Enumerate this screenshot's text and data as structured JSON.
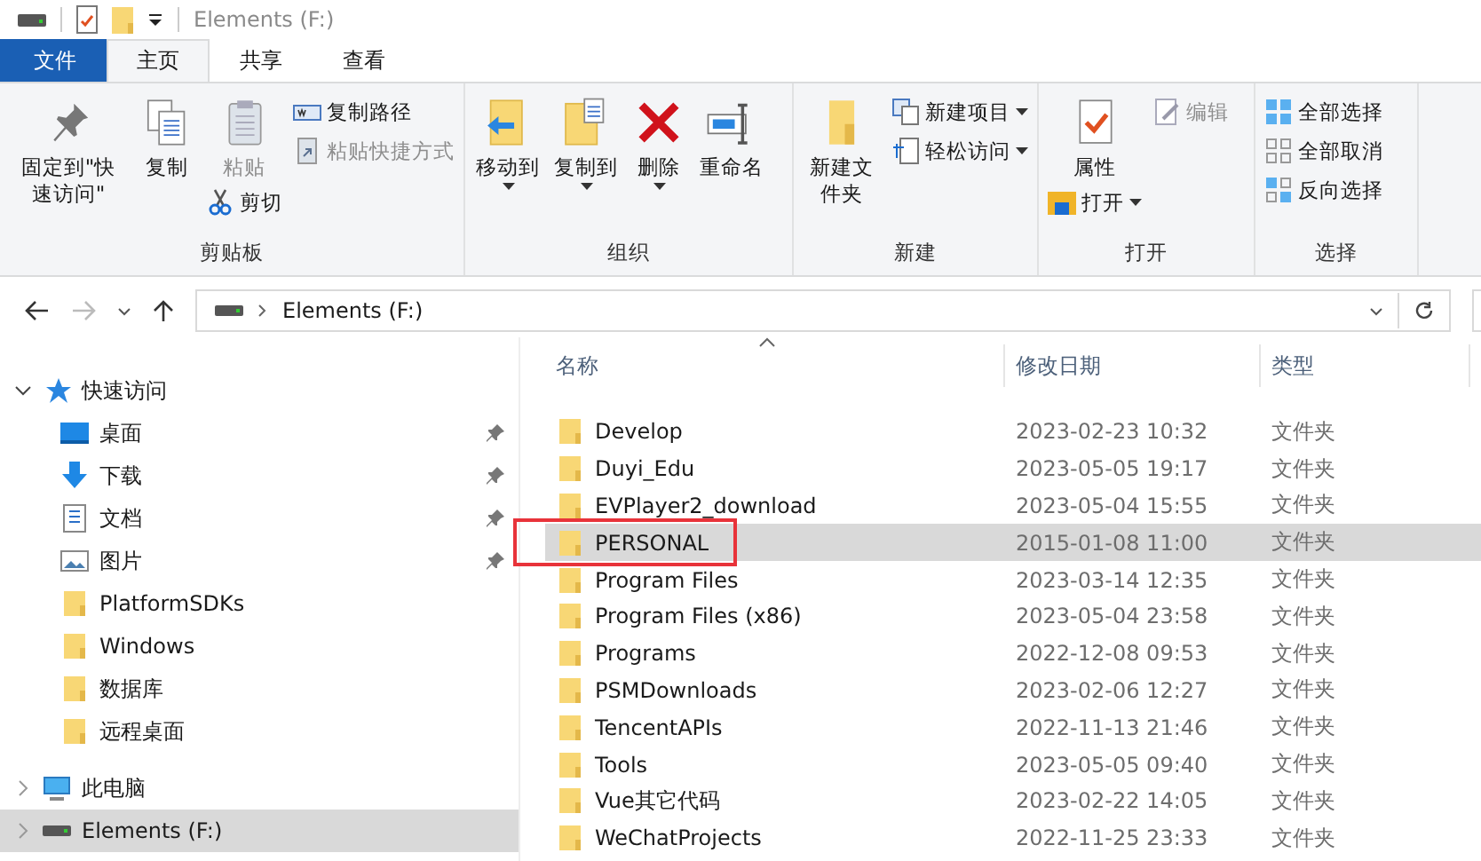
{
  "window": {
    "title": "Elements (F:)"
  },
  "tabs": [
    {
      "label": "文件",
      "kind": "file",
      "selected": false
    },
    {
      "label": "主页",
      "kind": "tab",
      "selected": true
    },
    {
      "label": "共享",
      "kind": "tab",
      "selected": false
    },
    {
      "label": "查看",
      "kind": "tab",
      "selected": false
    }
  ],
  "ribbon": {
    "groups": [
      {
        "label": "剪贴板",
        "items": [
          {
            "kind": "large",
            "label": "固定到\"快速访问\"",
            "disabled": false,
            "dropdown": false
          },
          {
            "kind": "large",
            "label": "复制",
            "disabled": false,
            "dropdown": false
          },
          {
            "kind": "large",
            "label": "粘贴",
            "disabled": true,
            "dropdown": false,
            "below": {
              "label": "剪切",
              "disabled": false,
              "dropdown": false
            }
          },
          {
            "kind": "column",
            "items": [
              {
                "label": "复制路径",
                "disabled": false,
                "dropdown": false
              },
              {
                "label": "粘贴快捷方式",
                "disabled": true,
                "dropdown": false
              }
            ]
          }
        ]
      },
      {
        "label": "组织",
        "items": [
          {
            "kind": "large",
            "label": "移动到",
            "disabled": false,
            "dropdown": true
          },
          {
            "kind": "large",
            "label": "复制到",
            "disabled": false,
            "dropdown": true
          },
          {
            "kind": "large",
            "label": "删除",
            "disabled": false,
            "dropdown": true
          },
          {
            "kind": "large",
            "label": "重命名",
            "disabled": false,
            "dropdown": false
          }
        ]
      },
      {
        "label": "新建",
        "items": [
          {
            "kind": "large",
            "label": "新建文件夹",
            "disabled": false,
            "dropdown": false
          },
          {
            "kind": "column",
            "items": [
              {
                "label": "新建项目",
                "disabled": false,
                "dropdown": true
              },
              {
                "label": "轻松访问",
                "disabled": false,
                "dropdown": true
              }
            ]
          }
        ]
      },
      {
        "label": "打开",
        "items": [
          {
            "kind": "large",
            "label": "属性",
            "disabled": false,
            "dropdown": false,
            "below": {
              "label": "打开",
              "disabled": false,
              "dropdown": true
            }
          },
          {
            "kind": "column",
            "items": [
              {
                "label": "编辑",
                "disabled": true,
                "dropdown": false
              }
            ]
          }
        ]
      },
      {
        "label": "选择",
        "items": [
          {
            "kind": "column",
            "items": [
              {
                "label": "全部选择",
                "disabled": false,
                "dropdown": false
              },
              {
                "label": "全部取消",
                "disabled": false,
                "dropdown": false
              },
              {
                "label": "反向选择",
                "disabled": false,
                "dropdown": false
              }
            ]
          }
        ]
      }
    ]
  },
  "address": {
    "path": "Elements (F:)"
  },
  "sidebar": {
    "items": [
      {
        "label": "快速访问",
        "kind": "star",
        "expanded": true,
        "selected": false,
        "children": [
          {
            "label": "桌面",
            "kind": "desktop",
            "pinned": true
          },
          {
            "label": "下载",
            "kind": "downloads",
            "pinned": true
          },
          {
            "label": "文档",
            "kind": "documents",
            "pinned": true
          },
          {
            "label": "图片",
            "kind": "pictures",
            "pinned": true
          },
          {
            "label": "PlatformSDKs",
            "kind": "folder",
            "pinned": false
          },
          {
            "label": "Windows",
            "kind": "folder",
            "pinned": false
          },
          {
            "label": "数据库",
            "kind": "folder",
            "pinned": false
          },
          {
            "label": "远程桌面",
            "kind": "folder",
            "pinned": false
          }
        ]
      },
      {
        "label": "此电脑",
        "kind": "pc",
        "expanded": false,
        "selected": false
      },
      {
        "label": "Elements (F:)",
        "kind": "drive",
        "expanded": false,
        "selected": true
      }
    ]
  },
  "table": {
    "columns": [
      "名称",
      "修改日期",
      "类型"
    ],
    "rows": [
      {
        "name": "Develop",
        "date": "2023-02-23 10:32",
        "type": "文件夹",
        "selected": false,
        "annotated": false
      },
      {
        "name": "Duyi_Edu",
        "date": "2023-05-05 19:17",
        "type": "文件夹",
        "selected": false,
        "annotated": false
      },
      {
        "name": "EVPlayer2_download",
        "date": "2023-05-04 15:55",
        "type": "文件夹",
        "selected": false,
        "annotated": false
      },
      {
        "name": "PERSONAL",
        "date": "2015-01-08 11:00",
        "type": "文件夹",
        "selected": true,
        "annotated": true
      },
      {
        "name": "Program Files",
        "date": "2023-03-14 12:35",
        "type": "文件夹",
        "selected": false,
        "annotated": false
      },
      {
        "name": "Program Files (x86)",
        "date": "2023-05-04 23:58",
        "type": "文件夹",
        "selected": false,
        "annotated": false
      },
      {
        "name": "Programs",
        "date": "2022-12-08 09:53",
        "type": "文件夹",
        "selected": false,
        "annotated": false
      },
      {
        "name": "PSMDownloads",
        "date": "2023-02-06 12:27",
        "type": "文件夹",
        "selected": false,
        "annotated": false
      },
      {
        "name": "TencentAPIs",
        "date": "2022-11-13 21:46",
        "type": "文件夹",
        "selected": false,
        "annotated": false
      },
      {
        "name": "Tools",
        "date": "2023-05-05 09:40",
        "type": "文件夹",
        "selected": false,
        "annotated": false
      },
      {
        "name": "Vue其它代码",
        "date": "2023-02-22 14:05",
        "type": "文件夹",
        "selected": false,
        "annotated": false
      },
      {
        "name": "WeChatProjects",
        "date": "2022-11-25 23:33",
        "type": "文件夹",
        "selected": false,
        "annotated": false
      }
    ]
  }
}
